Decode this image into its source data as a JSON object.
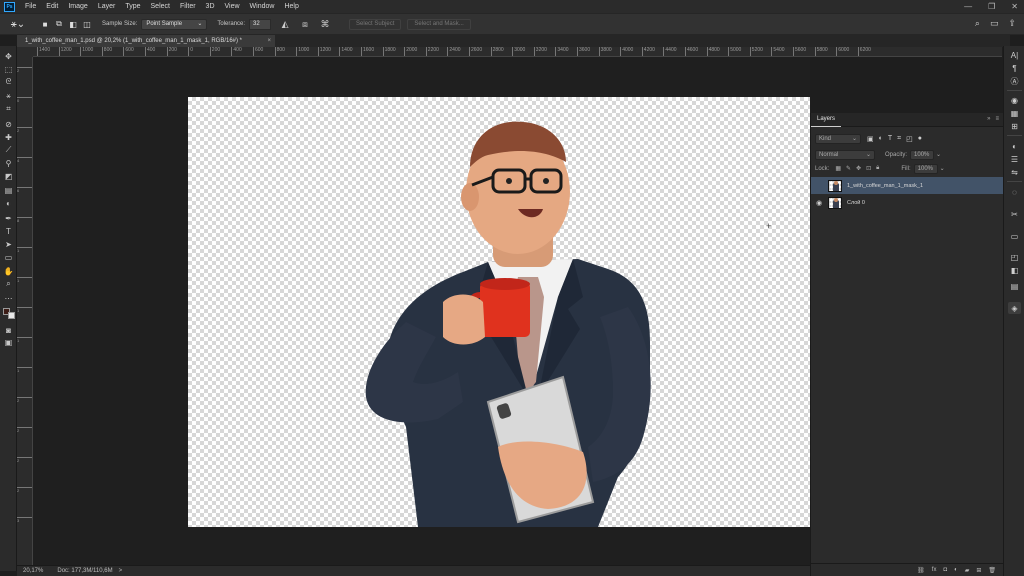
{
  "app": {
    "logo": "Ps",
    "menu": [
      "File",
      "Edit",
      "Image",
      "Layer",
      "Type",
      "Select",
      "Filter",
      "3D",
      "View",
      "Window",
      "Help"
    ],
    "window_controls": [
      "—",
      "❐",
      "✕"
    ]
  },
  "options_bar": {
    "tool_icon": "magic-wand-icon",
    "sample_size_label": "Sample Size:",
    "sample_size_value": "Point Sample",
    "tolerance_label": "Tolerance:",
    "tolerance_value": "32",
    "select_subject": "Select Subject",
    "select_and_mask": "Select and Mask..."
  },
  "document": {
    "tab_title": "1_with_coffee_man_1.psd @ 20,2% (1_with_coffee_man_1_mask_1, RGB/16#) *",
    "close": "×"
  },
  "ruler_h": [
    "1400",
    "1200",
    "1000",
    "800",
    "600",
    "400",
    "200",
    "0",
    "200",
    "400",
    "600",
    "800",
    "1000",
    "1200",
    "1400",
    "1600",
    "1800",
    "2000",
    "2200",
    "2400",
    "2600",
    "2800",
    "3000",
    "3200",
    "3400",
    "3600",
    "3800",
    "4000",
    "4200",
    "4400",
    "4600",
    "4800",
    "5000",
    "5200",
    "5400",
    "5600",
    "5800",
    "6000",
    "6200"
  ],
  "ruler_v": [
    "2",
    "0",
    "2",
    "4",
    "6",
    "8",
    "1",
    "1",
    "1",
    "1",
    "1",
    "2",
    "2",
    "2",
    "2",
    "3"
  ],
  "status": {
    "zoom": "20,17%",
    "doc": "Doc: 177,3M/110,6M",
    "arrow": ">"
  },
  "layers_panel": {
    "title": "Layers",
    "filter_kind": "Kind",
    "blend_mode": "Normal",
    "opacity_label": "Opacity:",
    "opacity_value": "100%",
    "lock_label": "Lock:",
    "fill_label": "Fill:",
    "fill_value": "100%",
    "layers": [
      {
        "name": "1_with_coffee_man_1_mask_1",
        "visible": false,
        "selected": true
      },
      {
        "name": "Слой 0",
        "visible": true,
        "selected": false
      }
    ]
  },
  "colors": {
    "accent": "#31a8ff",
    "selected_layer": "#425368",
    "foreground": "#3b1c16",
    "background": "#e9e9e9"
  }
}
